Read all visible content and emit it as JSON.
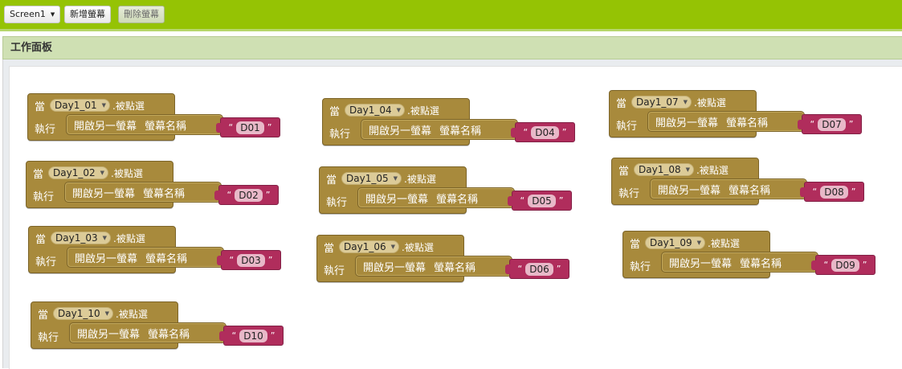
{
  "toolbar": {
    "screen_select": "Screen1",
    "add_screen": "新增螢幕",
    "remove_screen": "刪除螢幕"
  },
  "workspace": {
    "title": "工作面板"
  },
  "block_words": {
    "when": "當",
    "event": ".被點選",
    "do": "執行",
    "open_screen": "開啟另一螢幕",
    "screen_name": "螢幕名稱",
    "quote_open": "“",
    "quote_close": "”"
  },
  "blocks": [
    {
      "component": "Day1_01",
      "screen": "D01"
    },
    {
      "component": "Day1_02",
      "screen": "D02"
    },
    {
      "component": "Day1_03",
      "screen": "D03"
    },
    {
      "component": "Day1_04",
      "screen": "D04"
    },
    {
      "component": "Day1_05",
      "screen": "D05"
    },
    {
      "component": "Day1_06",
      "screen": "D06"
    },
    {
      "component": "Day1_07",
      "screen": "D07"
    },
    {
      "component": "Day1_08",
      "screen": "D08"
    },
    {
      "component": "Day1_09",
      "screen": "D09"
    },
    {
      "component": "Day1_10",
      "screen": "D10"
    }
  ],
  "colors": {
    "topbar": "#95c304",
    "control_block": "#a88a3c",
    "text_block": "#b02d5c"
  }
}
